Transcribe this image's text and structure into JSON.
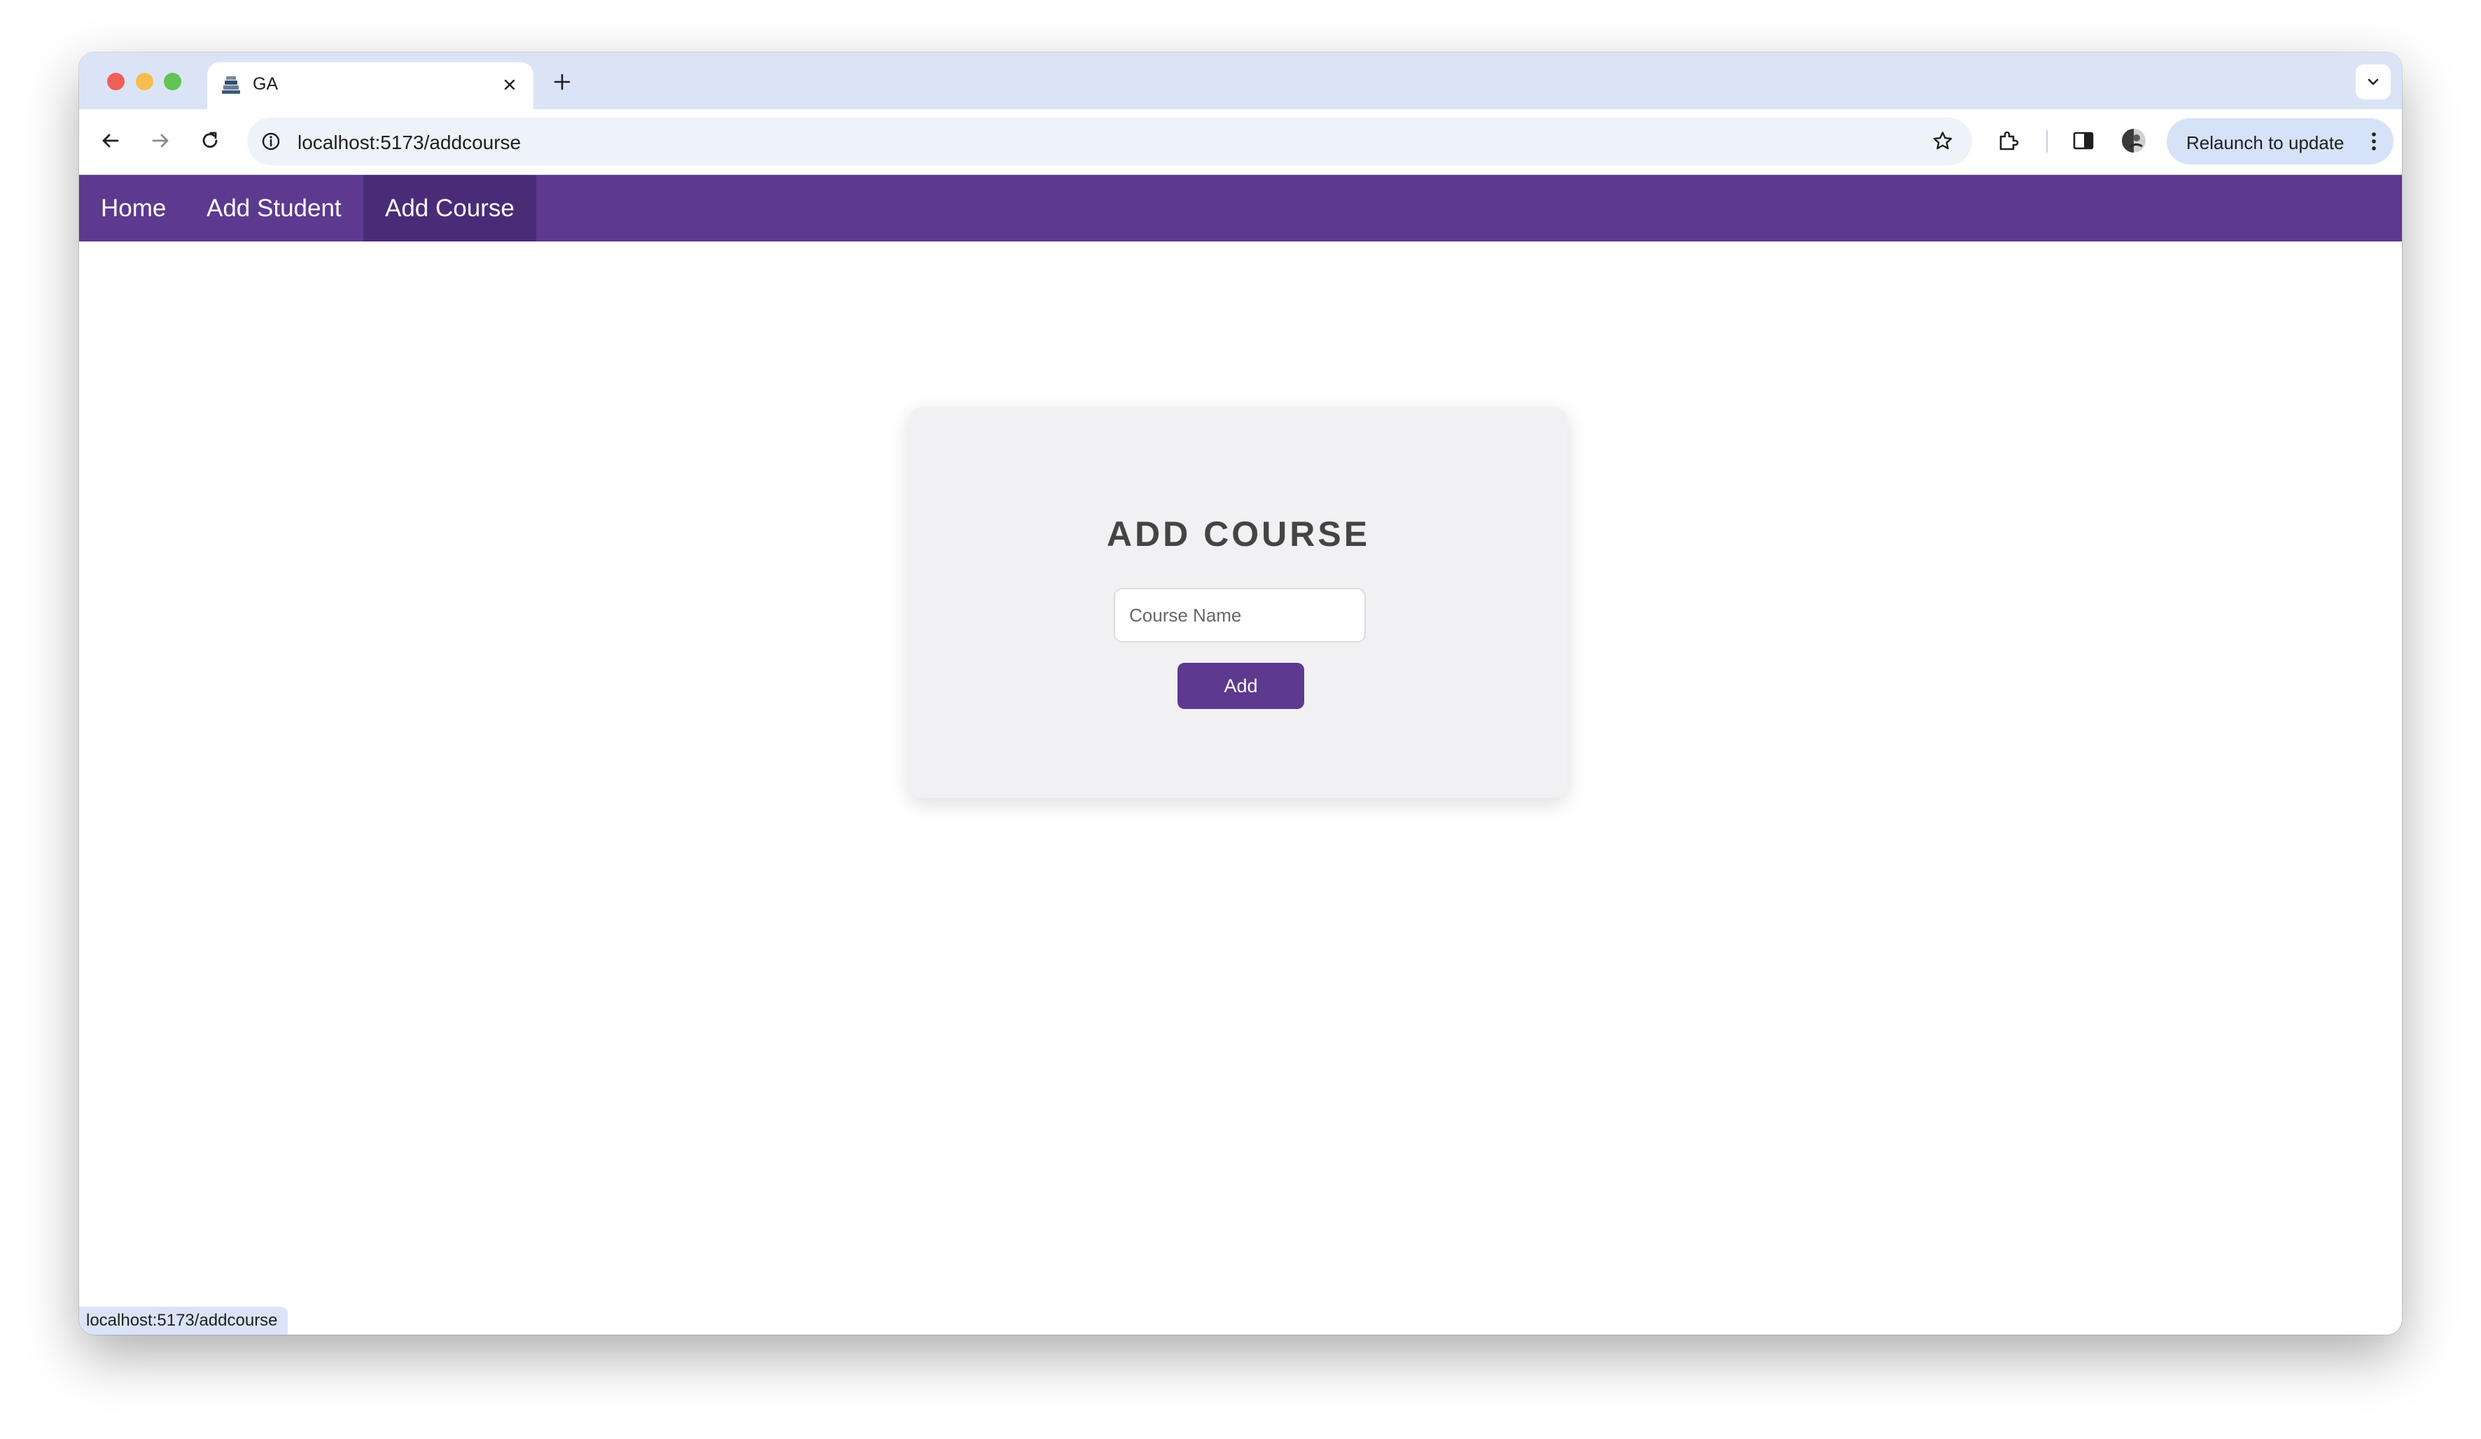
{
  "browser": {
    "tab": {
      "title": "GA",
      "favicon": "books-icon"
    },
    "address_bar": {
      "url": "localhost:5173/addcourse"
    },
    "relaunch_label": "Relaunch to update",
    "status_url": "localhost:5173/addcourse"
  },
  "navbar": {
    "links": [
      {
        "label": "Home",
        "active": false
      },
      {
        "label": "Add Student",
        "active": false
      },
      {
        "label": "Add Course",
        "active": true
      }
    ]
  },
  "form": {
    "title": "ADD COURSE",
    "course_name": {
      "placeholder": "Course Name",
      "value": ""
    },
    "submit_label": "Add"
  },
  "colors": {
    "accent": "#5d3990",
    "active_nav": "#4a2b78",
    "card_bg": "#f1f1f3",
    "tabstrip": "#dbe4f7"
  }
}
